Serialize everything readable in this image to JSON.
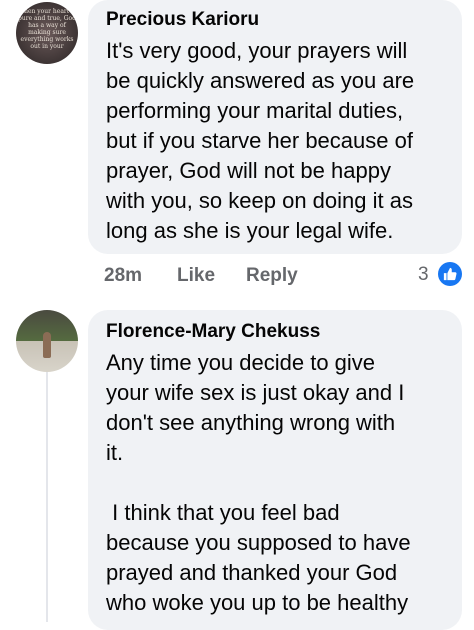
{
  "comments": [
    {
      "author": "Precious Karioru",
      "avatar_text": "When your heart is pure and true, God has a way of making sure everything works out in your",
      "text": "It's very good, your prayers will\nbe quickly answered as you are\nperforming your marital duties,\nbut if you starve her because of\nprayer, God will not be happy\nwith you, so keep on doing it as\nlong as she is your legal wife.",
      "time": "28m",
      "like_label": "Like",
      "reply_label": "Reply",
      "reaction_count": "3"
    },
    {
      "author": "Florence-Mary Chekuss",
      "text": "Any time you decide to give\nyour wife sex is just okay and I\ndon't see anything wrong with\nit.\n\n I think that you feel bad\nbecause you supposed to have\nprayed and thanked your God\nwho woke you up to be healthy"
    }
  ],
  "colors": {
    "bubble": "#f0f2f5",
    "meta": "#65676b",
    "like": "#1877f2"
  }
}
